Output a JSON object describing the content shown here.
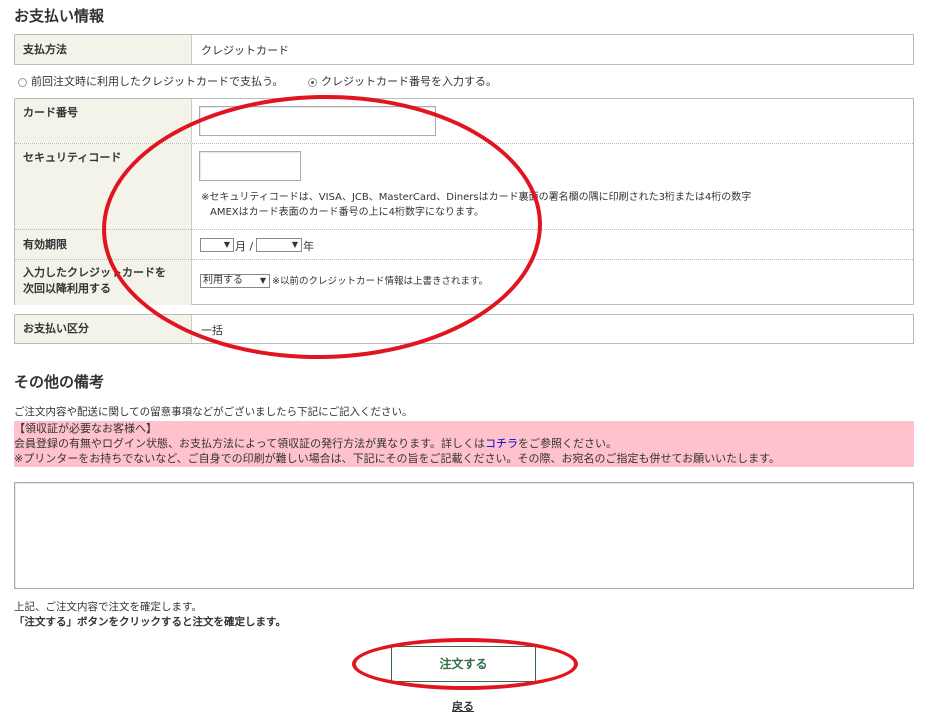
{
  "payment_section": {
    "title": "お支払い情報",
    "method_label": "支払方法",
    "method_value": "クレジットカード",
    "radio_previous_label": "前回注文時に利用したクレジットカードで支払う。",
    "radio_new_label": "クレジットカード番号を入力する。",
    "selected_option": "new",
    "card_number_label": "カード番号",
    "card_number_value": "",
    "security_code_label": "セキュリティコード",
    "security_code_value": "",
    "security_note_line1": "※セキュリティコードは、VISA、JCB、MasterCard、Dinersはカード裏面の署名欄の隅に印刷された3桁または4桁の数字",
    "security_note_line2": "AMEXはカード表面のカード番号の上に4桁数字になります。",
    "expiry_label": "有効期限",
    "expiry_month_value": "",
    "expiry_month_unit": "月 /",
    "expiry_year_value": "",
    "expiry_year_unit": "年",
    "save_card_label_line1": "入力したクレジットカードを",
    "save_card_label_line2": "次回以降利用する",
    "save_card_select_value": "利用する",
    "save_card_note": "※以前のクレジットカード情報は上書きされます。",
    "installment_label": "お支払い区分",
    "installment_value": "一括"
  },
  "remarks_section": {
    "title": "その他の備考",
    "intro": "ご注文内容や配送に関しての留意事項などがございましたら下記にご記入ください。",
    "receipt_heading": "【領収証が必要なお客様へ】",
    "receipt_line1_pre": "会員登録の有無やログイン状態、お支払方法によって領収証の発行方法が異なります。詳しくは",
    "receipt_link": "コチラ",
    "receipt_line1_post": "をご参照ください。",
    "receipt_line2": "※プリンターをお持ちでないなど、ご自身での印刷が難しい場合は、下記にその旨をご記載ください。その際、お宛名のご指定も併せてお願いいたします。",
    "textarea_value": ""
  },
  "confirm": {
    "line1": "上記、ご注文内容で注文を確定します。",
    "line2": "「注文する」ボタンをクリックすると注文を確定します。",
    "order_button": "注文する",
    "back_link": "戻る"
  },
  "colors": {
    "annotation": "#e0151f",
    "header_bg": "#f3f3ea",
    "pink_notice": "#ffc2cc",
    "button_green": "#356b4a",
    "link": "#0000cc"
  }
}
